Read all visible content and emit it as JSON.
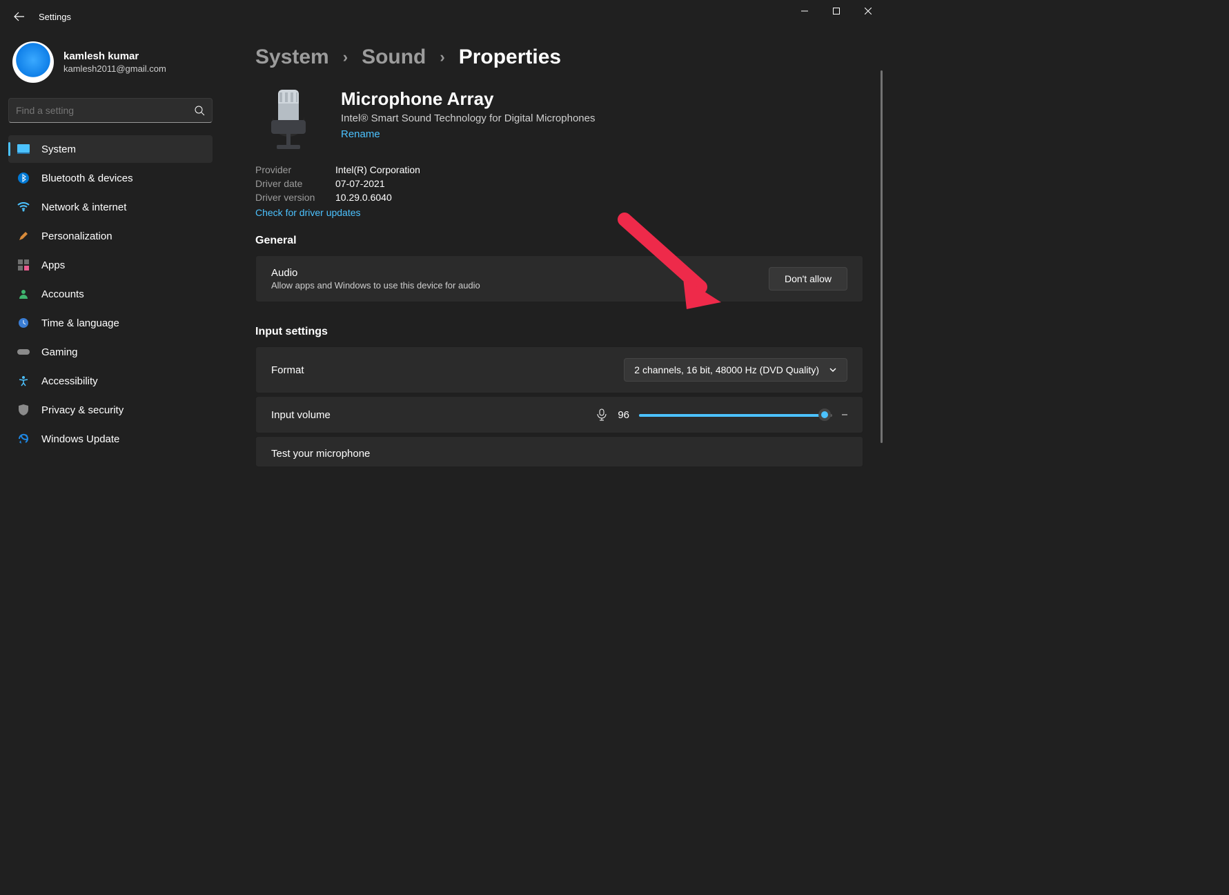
{
  "window": {
    "title": "Settings"
  },
  "user": {
    "name": "kamlesh kumar",
    "email": "kamlesh2011@gmail.com"
  },
  "search": {
    "placeholder": "Find a setting"
  },
  "nav": {
    "items": [
      {
        "key": "system",
        "label": "System",
        "active": true
      },
      {
        "key": "bluetooth",
        "label": "Bluetooth & devices"
      },
      {
        "key": "network",
        "label": "Network & internet"
      },
      {
        "key": "personalization",
        "label": "Personalization"
      },
      {
        "key": "apps",
        "label": "Apps"
      },
      {
        "key": "accounts",
        "label": "Accounts"
      },
      {
        "key": "time",
        "label": "Time & language"
      },
      {
        "key": "gaming",
        "label": "Gaming"
      },
      {
        "key": "accessibility",
        "label": "Accessibility"
      },
      {
        "key": "privacy",
        "label": "Privacy & security"
      },
      {
        "key": "update",
        "label": "Windows Update"
      }
    ]
  },
  "breadcrumb": {
    "a": "System",
    "b": "Sound",
    "c": "Properties"
  },
  "device": {
    "name": "Microphone Array",
    "subtitle": "Intel® Smart Sound Technology for Digital Microphones",
    "rename": "Rename",
    "rows": {
      "provider_label": "Provider",
      "provider_value": "Intel(R) Corporation",
      "date_label": "Driver date",
      "date_value": "07-07-2021",
      "version_label": "Driver version",
      "version_value": "10.29.0.6040"
    },
    "check_updates": "Check for driver updates"
  },
  "sections": {
    "general": "General",
    "audio_title": "Audio",
    "audio_sub": "Allow apps and Windows to use this device for audio",
    "dont_allow": "Don't allow",
    "input_settings": "Input settings",
    "format_label": "Format",
    "format_value": "2 channels, 16 bit, 48000 Hz (DVD Quality)",
    "input_volume_label": "Input volume",
    "input_volume_value": "96",
    "test_mic": "Test your microphone"
  }
}
